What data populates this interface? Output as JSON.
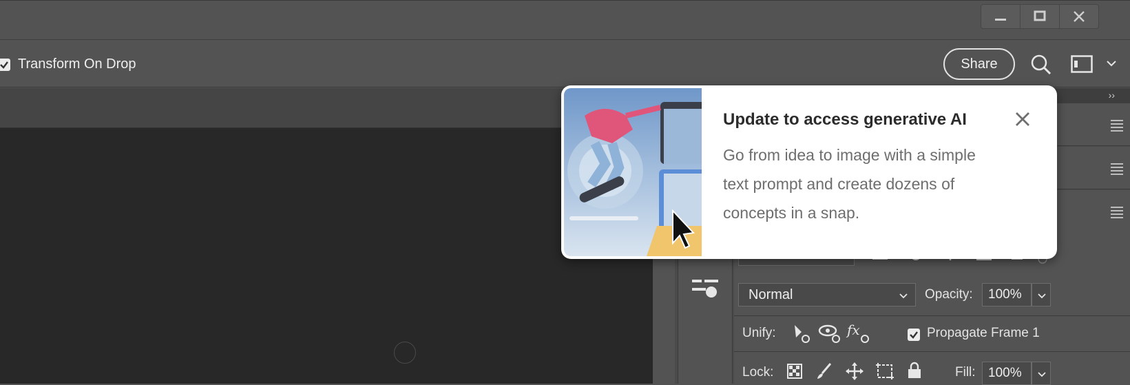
{
  "options_bar": {
    "transform_on_drop_label": "Transform On Drop",
    "transform_on_drop_checked": true,
    "share_label": "Share"
  },
  "popup": {
    "title": "Update to access generative AI",
    "body": "Go from idea to image with a simple text prompt and create dozens of concepts in a snap."
  },
  "layers_panel": {
    "blend_mode": "Normal",
    "opacity_label": "Opacity:",
    "opacity_value": "100%",
    "unify_label": "Unify:",
    "propagate_label": "Propagate Frame 1",
    "propagate_checked": true,
    "lock_label": "Lock:",
    "fill_label": "Fill:",
    "fill_value": "100%"
  },
  "colors": {
    "chrome": "#535353",
    "canvas": "#282828",
    "popup_bg": "#ffffff"
  }
}
